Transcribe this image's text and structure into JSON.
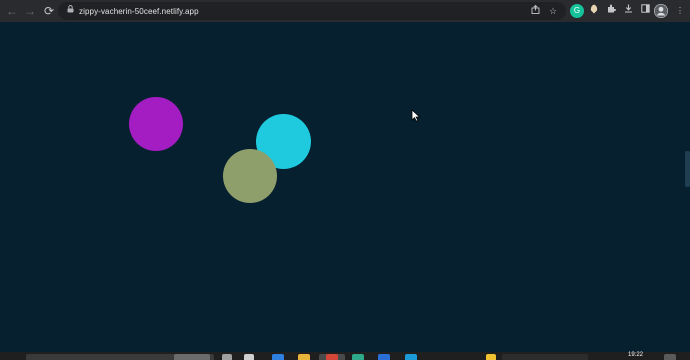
{
  "browser": {
    "url": "zippy-vacherin-50ceef.netlify.app",
    "icons": {
      "back": "arrow-left-icon",
      "forward": "arrow-right-icon",
      "reload": "reload-icon",
      "lock": "lock-icon",
      "share": "share-icon",
      "bookmark": "star-icon"
    },
    "extensions": [
      "grammarly-icon",
      "extension-icon",
      "puzzle-icon",
      "download-icon",
      "sidebar-icon",
      "profile-avatar",
      "menu-icon"
    ]
  },
  "canvas": {
    "background": "#06202f",
    "circles": [
      {
        "name": "magenta-circle",
        "color": "#a41dc3"
      },
      {
        "name": "cyan-circle",
        "color": "#1fcadf"
      },
      {
        "name": "olive-circle",
        "color": "#8f9f6b"
      }
    ]
  },
  "taskbar": {
    "clock": "19:22"
  }
}
